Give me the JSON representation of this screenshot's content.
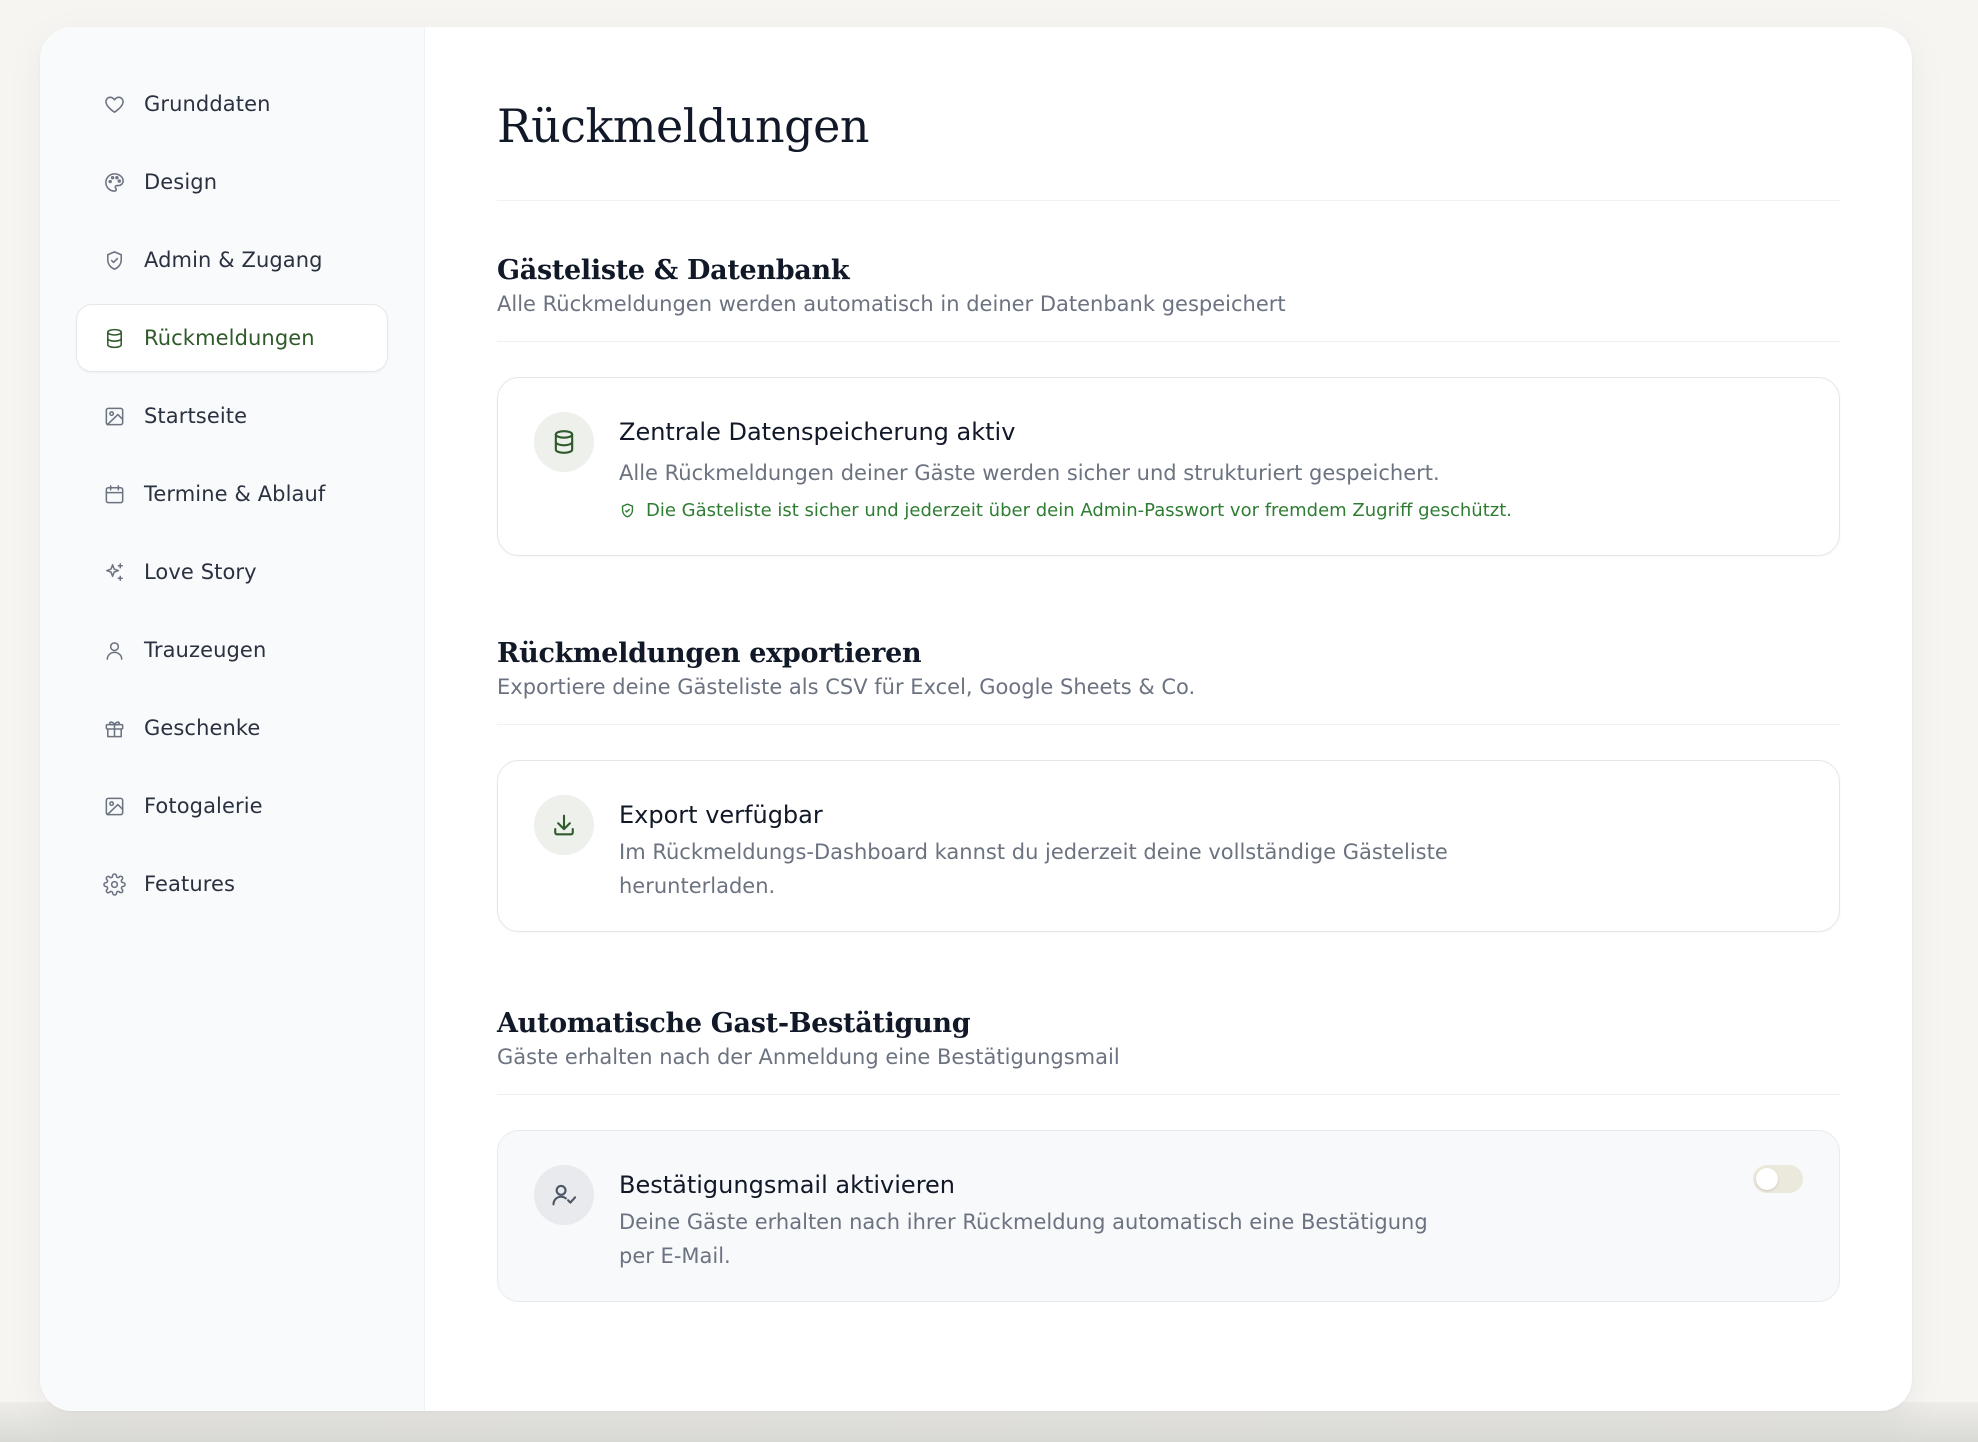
{
  "sidebar": {
    "items": [
      {
        "label": "Grunddaten",
        "icon": "heart-icon"
      },
      {
        "label": "Design",
        "icon": "palette-icon"
      },
      {
        "label": "Admin & Zugang",
        "icon": "shield-icon"
      },
      {
        "label": "Rückmeldungen",
        "icon": "database-icon",
        "active": true
      },
      {
        "label": "Startseite",
        "icon": "image-icon"
      },
      {
        "label": "Termine & Ablauf",
        "icon": "calendar-icon"
      },
      {
        "label": "Love Story",
        "icon": "sparkles-icon"
      },
      {
        "label": "Trauzeugen",
        "icon": "user-icon"
      },
      {
        "label": "Geschenke",
        "icon": "gift-icon"
      },
      {
        "label": "Fotogalerie",
        "icon": "image-icon"
      },
      {
        "label": "Features",
        "icon": "gear-icon"
      }
    ]
  },
  "main": {
    "title": "Rückmeldungen",
    "sections": [
      {
        "title": "Gästeliste & Datenbank",
        "subtitle": "Alle Rückmeldungen werden automatisch in deiner Datenbank gespeichert",
        "card": {
          "icon": "database-icon",
          "title": "Zentrale Datenspeicherung aktiv",
          "text": "Alle Rückmeldungen deiner Gäste werden sicher und strukturiert gespeichert.",
          "note": "Die Gästeliste ist sicher und jederzeit über dein Admin-Passwort vor fremdem Zugriff geschützt."
        }
      },
      {
        "title": "Rückmeldungen exportieren",
        "subtitle": "Exportiere deine Gästeliste als CSV für Excel, Google Sheets & Co.",
        "card": {
          "icon": "download-icon",
          "title": "Export verfügbar",
          "text": "Im Rückmeldungs-Dashboard kannst du jederzeit deine vollständige Gästeliste herunterladen."
        }
      },
      {
        "title": "Automatische Gast-Bestätigung",
        "subtitle": "Gäste erhalten nach der Anmeldung eine Bestätigungsmail",
        "card": {
          "icon": "user-check-icon",
          "title": "Bestätigungsmail aktivieren",
          "text": "Deine Gäste erhalten nach ihrer Rückmeldung automatisch eine Bestätigung per E-Mail.",
          "toggle_on": false
        }
      }
    ]
  },
  "colors": {
    "accent": "#2f5a2a",
    "success": "#2e7d32",
    "toggle_off": "#ebe8dc"
  }
}
